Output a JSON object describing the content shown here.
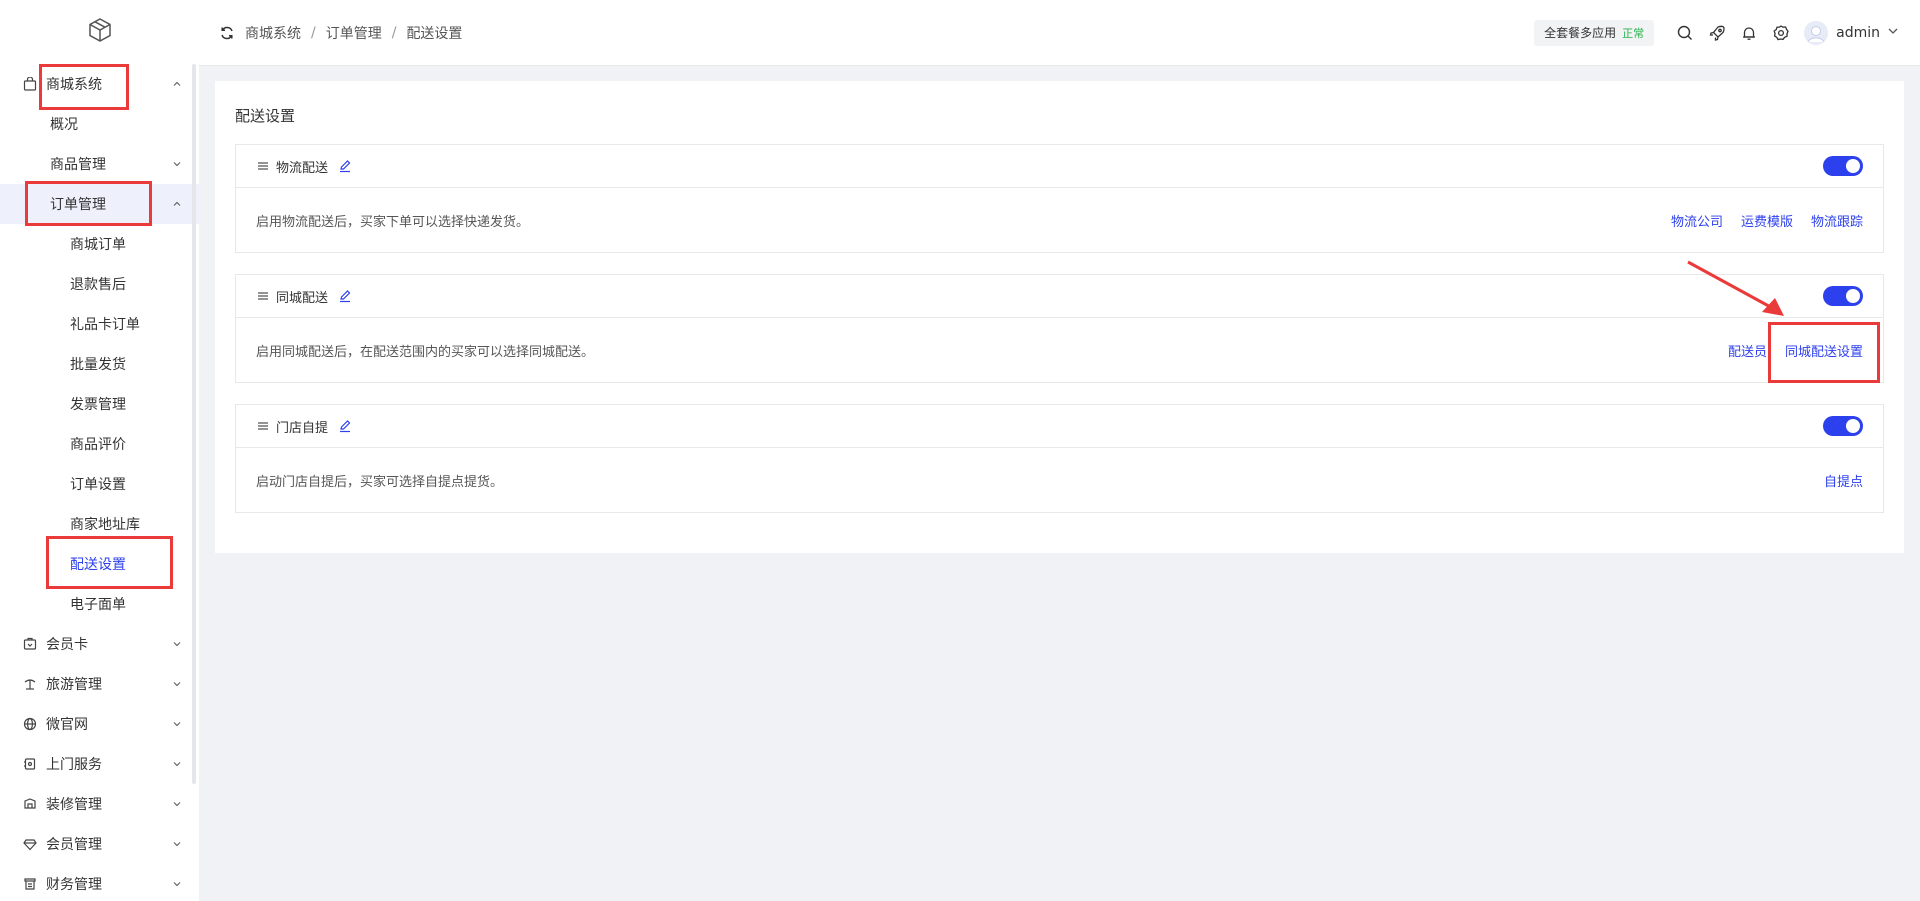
{
  "colors": {
    "accent": "#2d40ed",
    "highlight": "#ea3a3a",
    "status_green": "#26b34b"
  },
  "sidebar": {
    "logo_icon": "cube-icon",
    "items": [
      {
        "label": "商城系统",
        "icon": "bag-icon",
        "expanded": true
      },
      {
        "label": "概况"
      },
      {
        "label": "商品管理"
      },
      {
        "label": "订单管理"
      },
      {
        "label": "商城订单"
      },
      {
        "label": "退款售后"
      },
      {
        "label": "礼品卡订单"
      },
      {
        "label": "批量发货"
      },
      {
        "label": "发票管理"
      },
      {
        "label": "商品评价"
      },
      {
        "label": "订单设置"
      },
      {
        "label": "商家地址库"
      },
      {
        "label": "配送设置"
      },
      {
        "label": "电子面单"
      },
      {
        "label": "会员卡",
        "icon": "card-icon"
      },
      {
        "label": "旅游管理",
        "icon": "travel-icon"
      },
      {
        "label": "微官网",
        "icon": "globe-icon"
      },
      {
        "label": "上门服务",
        "icon": "service-icon"
      },
      {
        "label": "装修管理",
        "icon": "decor-icon"
      },
      {
        "label": "会员管理",
        "icon": "diamond-icon"
      },
      {
        "label": "财务管理",
        "icon": "finance-icon"
      }
    ]
  },
  "header": {
    "breadcrumb": [
      "商城系统",
      "订单管理",
      "配送设置"
    ],
    "package_label": "全套餐多应用",
    "package_status": "正常",
    "username": "admin"
  },
  "main": {
    "title": "配送设置",
    "cards": [
      {
        "title": "物流配送",
        "enabled": true,
        "desc": "启用物流配送后，买家下单可以选择快递发货。",
        "links": [
          "物流公司",
          "运费模版",
          "物流跟踪"
        ]
      },
      {
        "title": "同城配送",
        "enabled": true,
        "desc": "启用同城配送后，在配送范围内的买家可以选择同城配送。",
        "links": [
          "配送员",
          "同城配送设置"
        ]
      },
      {
        "title": "门店自提",
        "enabled": true,
        "desc": "启动门店自提后，买家可选择自提点提货。",
        "links": [
          "自提点"
        ]
      }
    ]
  }
}
